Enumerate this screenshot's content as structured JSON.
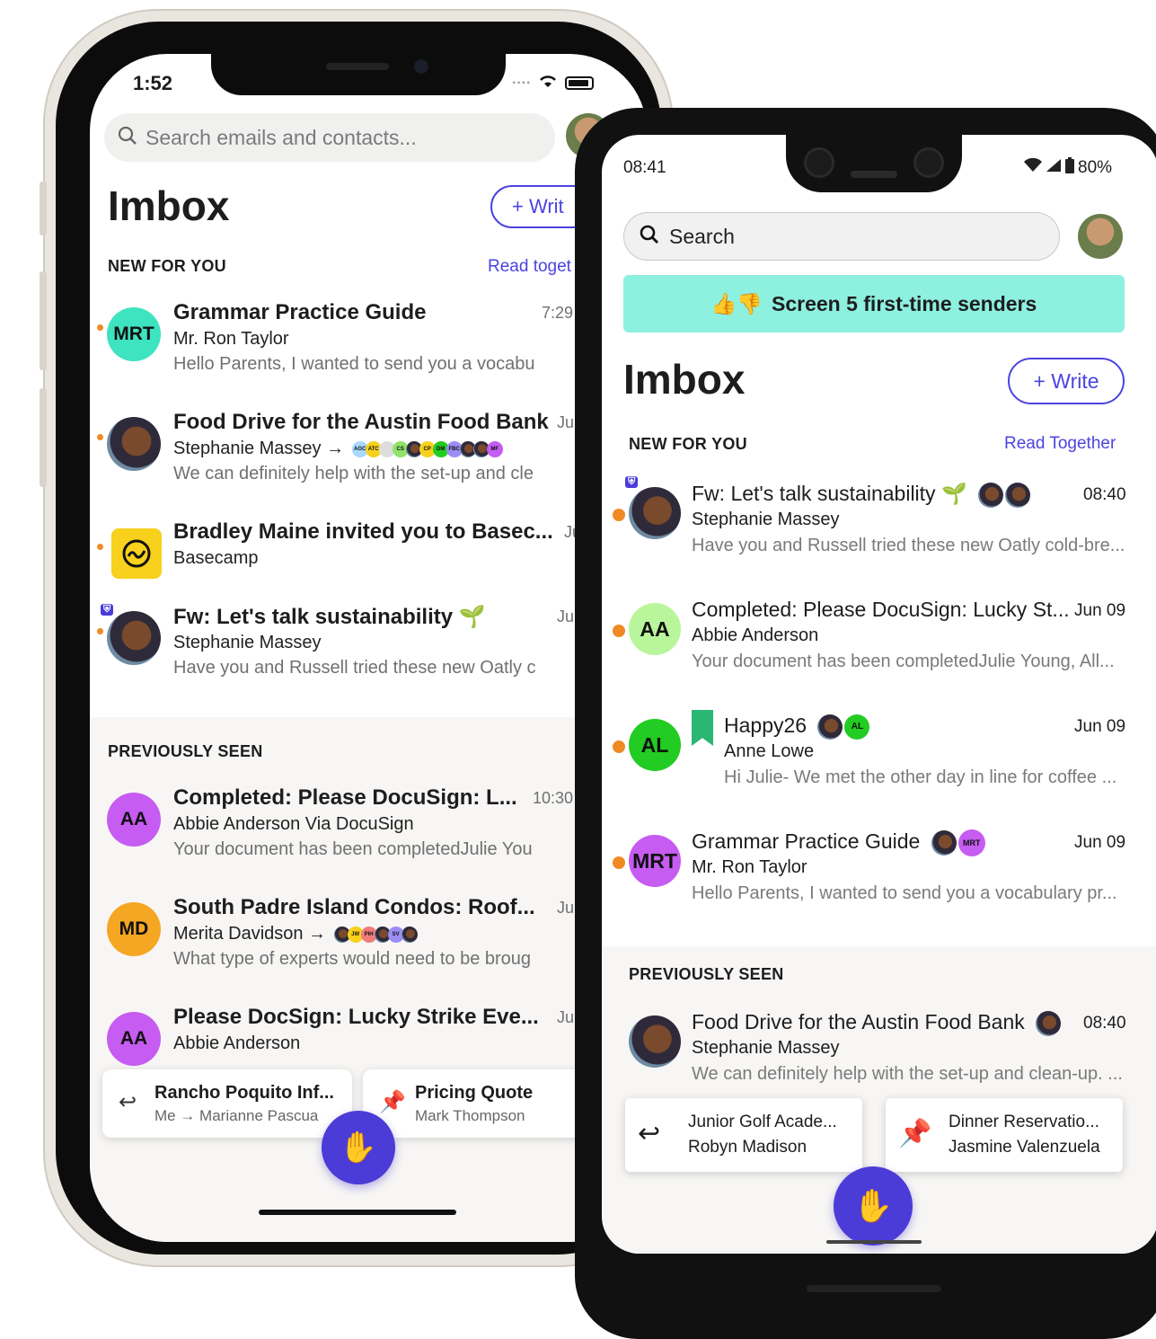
{
  "colors": {
    "accent": "#4b44e0",
    "unread": "#f08a24",
    "screener_bg": "#8ef0df"
  },
  "iphone": {
    "status_time": "1:52",
    "search_placeholder": "Search emails and contacts...",
    "title": "Imbox",
    "write_label": "+ Writ",
    "new_section": "NEW FOR YOU",
    "read_together": "Read toget",
    "previously_section": "PREVIOUSLY SEEN",
    "new_items": [
      {
        "avatar_text": "MRT",
        "avatar_color": "#3ee3c0",
        "subject": "Grammar Practice Guide",
        "from": "Mr. Ron Taylor",
        "preview": "Hello Parents, I wanted to send you a vocabu",
        "time": "7:29"
      },
      {
        "avatar_text": "",
        "avatar_color": "",
        "subject": "Food Drive for the Austin Food Bank",
        "from": "Stephanie Massey →",
        "preview": "We can definitely help with the set-up and cle",
        "time": "Ju"
      },
      {
        "avatar_text": "",
        "avatar_color": "#f7d11c",
        "subject": "Bradley Maine invited you to Basec...",
        "from": "Basecamp",
        "preview": "",
        "time": "Ju"
      },
      {
        "avatar_text": "",
        "avatar_color": "",
        "subject": "Fw: Let's talk sustainability 🌱",
        "from": "Stephanie Massey",
        "preview": "Have you and Russell tried these new Oatly c",
        "time": "Ju"
      }
    ],
    "prev_items": [
      {
        "avatar_text": "AA",
        "avatar_color": "#c65cf2",
        "subject": "Completed: Please DocuSign: L...",
        "from": "Abbie Anderson Via DocuSign",
        "preview": "Your document has been completedJulie You",
        "time": "10:30"
      },
      {
        "avatar_text": "MD",
        "avatar_color": "#f5a623",
        "subject": "South Padre Island Condos: Roof...",
        "from": "Merita Davidson →",
        "preview": "What type of experts would need to be broug",
        "time": "Ju"
      },
      {
        "avatar_text": "AA",
        "avatar_color": "#c65cf2",
        "subject": "Please DocSign: Lucky Strike Eve...",
        "from": "Abbie Anderson",
        "preview": "",
        "time": "Ju"
      }
    ],
    "food_tags": [
      "AGC",
      "ATC",
      "",
      "CS",
      "",
      "CP",
      "DM",
      "FBC",
      "",
      "",
      "MF"
    ],
    "merita_tags": [
      "",
      "JW",
      "PIH",
      "",
      "SV",
      ""
    ],
    "tray": [
      {
        "title": "Rancho Poquito Inf...",
        "sub": "Me → Marianne Pascua"
      },
      {
        "title": "Pricing Quote",
        "sub": "Mark Thompson"
      }
    ]
  },
  "android": {
    "status_time": "08:41",
    "battery": "80%",
    "search_placeholder": "Search",
    "screener": "Screen 5 first-time senders",
    "title": "Imbox",
    "write_label": "+ Write",
    "new_section": "NEW FOR YOU",
    "read_together": "Read Together",
    "previously_section": "PREVIOUSLY SEEN",
    "new_items": [
      {
        "avatar_text": "",
        "avatar_color": "",
        "subject": "Fw: Let's talk sustainability 🌱",
        "from": "Stephanie Massey",
        "preview": "Have you and Russell tried these new Oatly cold-bre...",
        "time": "08:40"
      },
      {
        "avatar_text": "AA",
        "avatar_color": "#b9f59a",
        "subject": "Completed: Please DocuSign: Lucky St...",
        "from": "Abbie Anderson",
        "preview": "Your document has been completedJulie Young, All...",
        "time": "Jun 09"
      },
      {
        "avatar_text": "AL",
        "avatar_color": "#22cc22",
        "subject": "Happy26",
        "from": "Anne Lowe",
        "preview": "Hi Julie- We met the other day in line for coffee ...",
        "time": "Jun 09",
        "mini": "AL"
      },
      {
        "avatar_text": "MRT",
        "avatar_color": "#c65cf2",
        "subject": "Grammar Practice Guide",
        "from": "Mr. Ron Taylor",
        "preview": "Hello Parents, I wanted to send you a vocabulary pr...",
        "time": "Jun 09",
        "mini": "MRT"
      }
    ],
    "prev_items": [
      {
        "avatar_text": "",
        "avatar_color": "",
        "subject": "Food Drive for the Austin Food Bank",
        "from": "Stephanie Massey",
        "preview": "We can definitely help with the set-up and clean-up. ...",
        "time": "08:40"
      }
    ],
    "tray": [
      {
        "title": "Junior Golf Acade...",
        "sub": "Robyn Madison"
      },
      {
        "title": "Dinner Reservatio...",
        "sub": "Jasmine Valenzuela"
      }
    ]
  }
}
